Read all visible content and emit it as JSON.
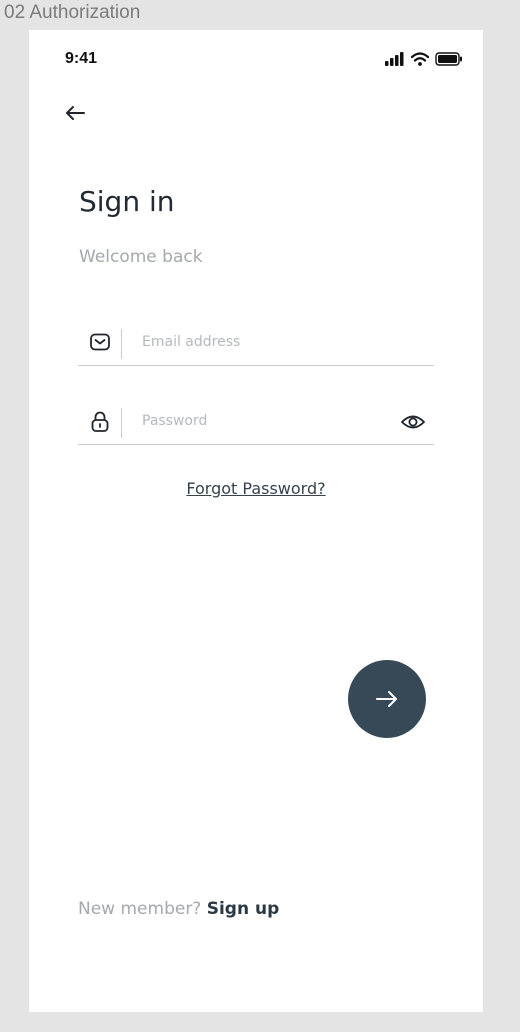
{
  "frame_label": "02 Authorization",
  "status_bar": {
    "time": "9:41",
    "icons": [
      "cellular-signal-icon",
      "wifi-icon",
      "battery-icon"
    ]
  },
  "header": {
    "back_icon": "arrow-left-icon"
  },
  "title": "Sign in",
  "subtitle": "Welcome back",
  "email_field": {
    "icon": "mail-icon",
    "placeholder": "Email address",
    "value": ""
  },
  "password_field": {
    "icon": "lock-icon",
    "placeholder": "Password",
    "value": "",
    "toggle_icon": "eye-icon"
  },
  "forgot_password": "Forgot Password?",
  "next_button": {
    "icon": "arrow-right-icon",
    "color": "#374956"
  },
  "signup": {
    "prompt": "New member?",
    "link": "Sign up"
  },
  "colors": {
    "primary": "#374956",
    "text_dark": "#222a33",
    "text_muted": "#a5a8ac",
    "canvas_bg": "#e4e4e4",
    "screen_bg": "#ffffff"
  }
}
